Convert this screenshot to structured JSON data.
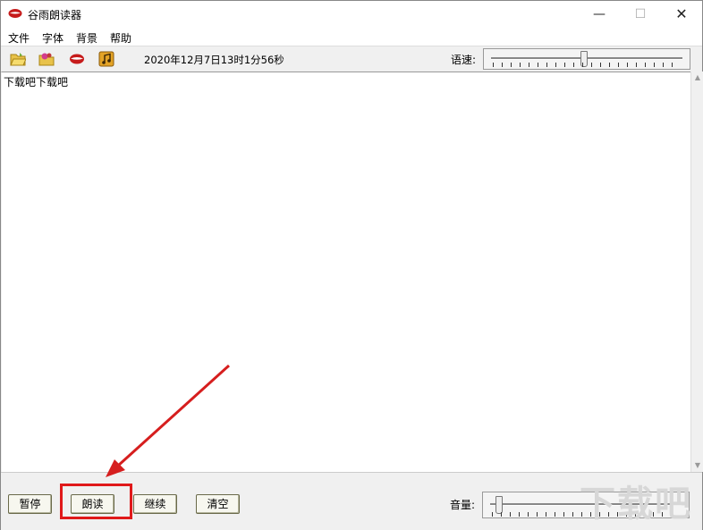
{
  "window": {
    "title": "谷雨朗读器",
    "minimize": "—",
    "maximize": "☐",
    "close": "✕"
  },
  "menu": [
    {
      "label": "文件"
    },
    {
      "label": "字体"
    },
    {
      "label": "背景"
    },
    {
      "label": "帮助"
    }
  ],
  "toolbar": {
    "icons": [
      "open-folder-icon",
      "favorite-folder-icon",
      "lips-icon",
      "music-icon"
    ],
    "datetime": "2020年12月7日13时1分56秒",
    "speed_label": "语速:",
    "speed_level": 0.48
  },
  "editor": {
    "text": "下载吧下载吧"
  },
  "buttons": {
    "pause": "暂停",
    "read": "朗读",
    "continue": "继续",
    "clear": "清空"
  },
  "volume": {
    "label": "音量:",
    "level": 0.02
  },
  "watermark": "下载吧",
  "colors": {
    "highlight": "#e0191a",
    "arrow": "#d61e1e"
  }
}
